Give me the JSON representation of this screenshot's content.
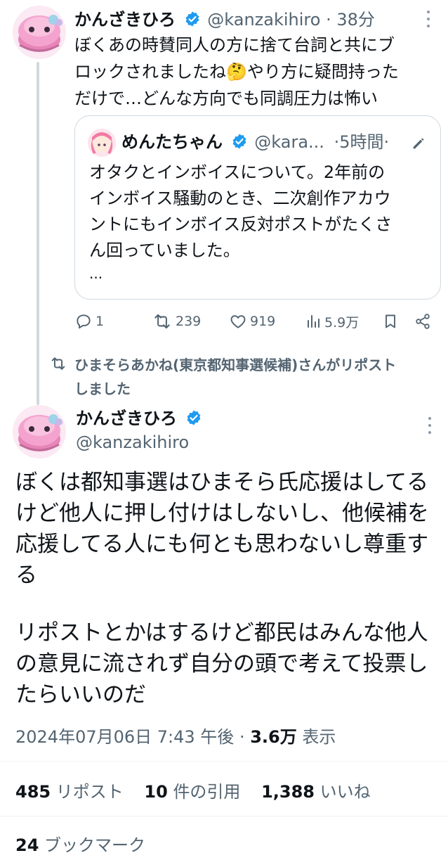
{
  "quoting_tweet": {
    "display_name": "かんざきひろ",
    "handle": "@kanzakihiro",
    "separator": "·",
    "time": "38分",
    "text_lines": [
      "ぼくあの時賛同人の方に捨て台詞と共にブ",
      "ロックされましたね🤔やり方に疑問持った",
      "だけで…どんな方向でも同調圧力は怖い"
    ],
    "quoted": {
      "display_name": "めんたちゃん",
      "handle": "@kara...",
      "time": "·5時間·",
      "text_lines": [
        "オタクとインボイスについて。2年前の",
        "インボイス騒動のとき、二次創作アカウ",
        "ントにもインボイス反対ポストがたくさ",
        "ん回っていました。",
        "..."
      ]
    },
    "actions": {
      "replies": "1",
      "retweets": "239",
      "likes": "919",
      "views": "5.9万"
    }
  },
  "retweet_banner": {
    "lines": [
      "ひまそらあかね(東京都知事選候補)さんがリポスト",
      "しました"
    ]
  },
  "main_tweet": {
    "display_name": "かんざきひろ",
    "handle": "@kanzakihiro",
    "text_lines": [
      "ぼくは都知事選はひまそら氏応援はしてる",
      "けど他人に押し付けはしないし、他候補を",
      "応援してる人にも何とも思わないし尊重す",
      "る",
      "",
      "リポストとかはするけど都民はみんな他人",
      "の意見に流されず自分の頭で考えて投票し",
      "たらいいのだ"
    ],
    "timestamp": "2024年07月06日 7:43 午後",
    "meta_sep": "·",
    "views_count": "3.6万",
    "views_label": "表示",
    "stats": {
      "reposts_count": "485",
      "reposts_label": "リポスト",
      "quotes_count": "10",
      "quotes_label": "件の引用",
      "likes_count": "1,388",
      "likes_label": "いいね",
      "bookmarks_count": "24",
      "bookmarks_label": "ブックマーク"
    }
  },
  "colors": {
    "verified": "#1d9bf0",
    "muted": "#536471",
    "text": "#0f1419",
    "avatar_pink": "#f08cc0"
  }
}
